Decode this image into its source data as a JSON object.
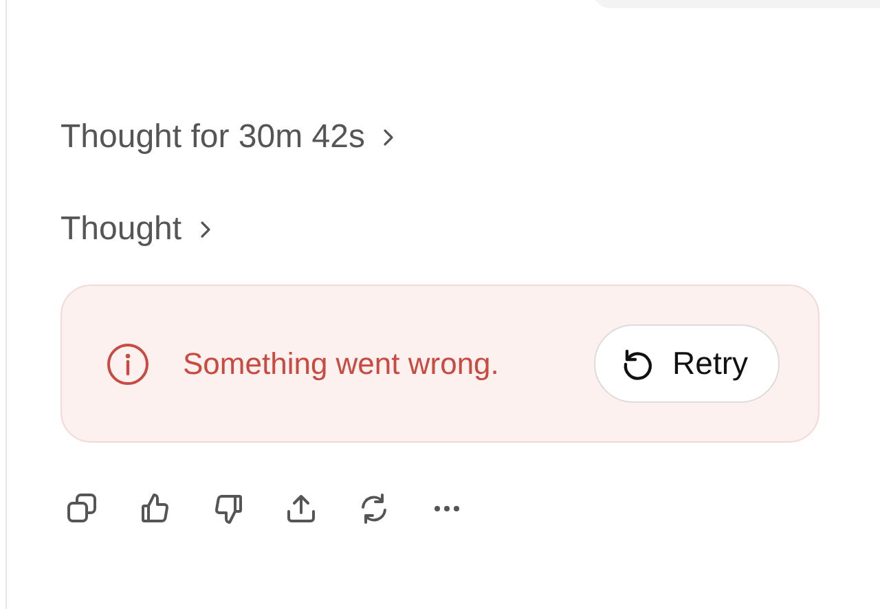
{
  "thoughts": [
    {
      "label": "Thought for 30m 42s"
    },
    {
      "label": "Thought"
    }
  ],
  "error": {
    "message": "Something went wrong.",
    "button": "Retry"
  }
}
